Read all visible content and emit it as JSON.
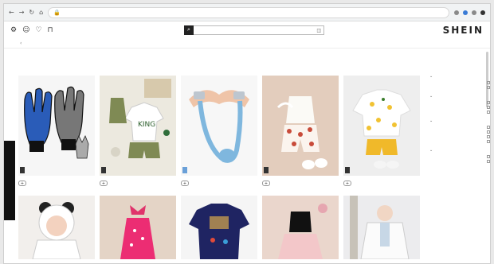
{
  "browser": {
    "url": "",
    "nav": [
      "←",
      "→",
      "↻",
      "⌂"
    ]
  },
  "header": {
    "logo": "SHEIN",
    "search_placeholder": "",
    "icons": [
      "gear-icon",
      "user-icon",
      "heart-icon",
      "bag-icon"
    ]
  },
  "categories": [],
  "breadcrumb": "",
  "sort_labels": [],
  "products": [
    {
      "name": "",
      "price": "",
      "sale": false
    },
    {
      "name": "",
      "price": "",
      "sale": true
    },
    {
      "name": "",
      "price": "",
      "sale": false
    },
    {
      "name": "",
      "price": "",
      "sale": false
    },
    {
      "name": "",
      "price": "",
      "sale": false
    },
    {
      "name": "",
      "price": "",
      "sale": false
    },
    {
      "name": "",
      "price": "",
      "sale": false
    },
    {
      "name": "",
      "price": "",
      "sale": false
    },
    {
      "name": "",
      "price": "",
      "sale": false
    },
    {
      "name": "",
      "price": "",
      "sale": false
    }
  ],
  "side_tab": "",
  "filters": [
    {
      "title": "",
      "options": []
    },
    {
      "title": "",
      "options": []
    },
    {
      "title": "",
      "options": []
    },
    {
      "title": "",
      "options": []
    }
  ]
}
